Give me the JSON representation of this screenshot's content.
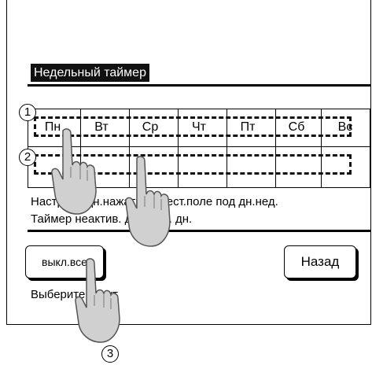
{
  "screen": {
    "title": "Недельный таймер",
    "days": [
      "Пн",
      "Вт",
      "Ср",
      "Чт",
      "Пт",
      "Сб",
      "Вс"
    ],
    "info_line_1": "Настр.акт.дн.нажать на тест.поле под дн.нед.",
    "info_line_2": "Таймер неактив. для вых. дн.",
    "all_off_label": "выкл.все",
    "back_label": "Назад",
    "hint_text": "Выберите пункт"
  },
  "callouts": {
    "one": "1",
    "two": "2",
    "three": "3"
  },
  "icons": {
    "hand": "pointing-hand-icon"
  }
}
